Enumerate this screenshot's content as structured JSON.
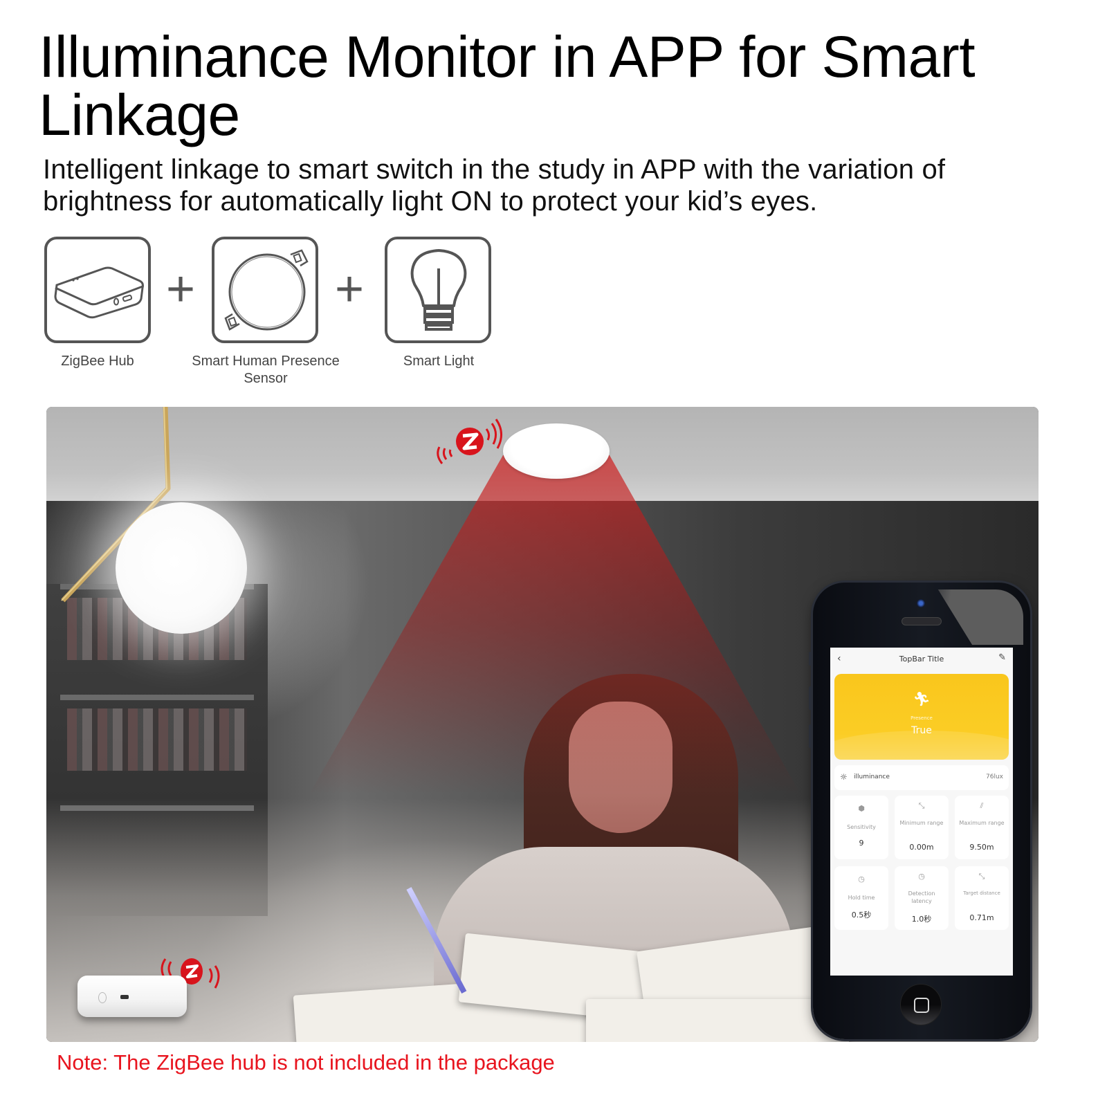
{
  "header": {
    "title": "Illuminance Monitor in APP for Smart Linkage",
    "subtitle": "Intelligent linkage to smart switch in the study in APP with the variation of brightness for automatically light ON to protect your kid’s eyes."
  },
  "combo": {
    "items": [
      {
        "icon": "zigbee-hub-icon",
        "label": "ZigBee Hub"
      },
      {
        "icon": "presence-sensor-icon",
        "label": "Smart Human Presence Sensor"
      },
      {
        "icon": "light-bulb-icon",
        "label": "Smart Light"
      }
    ],
    "separator": "+"
  },
  "app": {
    "topbar": {
      "back_icon": "‹",
      "title": "TopBar Title",
      "edit_icon": "✎"
    },
    "presence": {
      "icon": "running-person-icon",
      "label": "Presence",
      "value": "True"
    },
    "illuminance": {
      "icon": "sun-icon",
      "label": "illuminance",
      "value": "76lux"
    },
    "tiles": [
      {
        "icon": "hexagon-nut-icon",
        "label": "Sensitivity",
        "value": "9"
      },
      {
        "icon": "range-icon",
        "label": "Minimum range",
        "value": "0.00m"
      },
      {
        "icon": "range-max-icon",
        "label": "Maximum range",
        "value": "9.50m"
      },
      {
        "icon": "clock-icon",
        "label": "Hold time",
        "value": "0.5秒"
      },
      {
        "icon": "clock-icon",
        "label": "Detection latency",
        "value": "1.0秒"
      },
      {
        "icon": "distance-icon",
        "label": "Target distance",
        "value": "0.71m"
      }
    ]
  },
  "colors": {
    "accent_yellow": "#FBCD25",
    "note_red": "#E8141E",
    "zigbee_red": "#D8141C",
    "beam_red": "#C81E1E"
  },
  "note": "Note: The ZigBee hub is not included in the package"
}
